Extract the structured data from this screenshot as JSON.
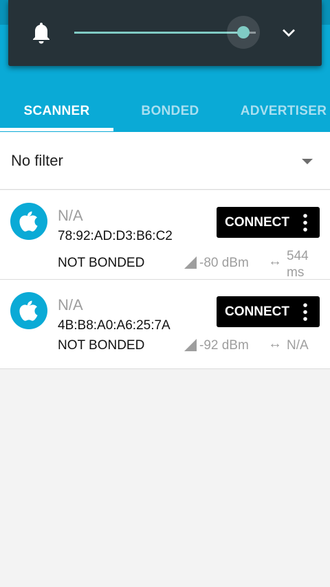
{
  "volume_panel": {
    "icon": "bell-icon",
    "level": 0.93,
    "accent_color": "#80cbc4",
    "expand_icon": "chevron-down-icon"
  },
  "tabs": [
    {
      "label": "SCANNER",
      "active": true
    },
    {
      "label": "BONDED",
      "active": false
    },
    {
      "label": "ADVERTISER",
      "active": false
    }
  ],
  "filter": {
    "selected": "No filter"
  },
  "devices": [
    {
      "icon": "apple-icon",
      "name": "N/A",
      "address": "78:92:AD:D3:B6:C2",
      "bond_state": "NOT BONDED",
      "connect_label": "CONNECT",
      "rssi": "-80 dBm",
      "interval_line1": "544",
      "interval_line2": "ms"
    },
    {
      "icon": "apple-icon",
      "name": "N/A",
      "address": "4B:B8:A0:A6:25:7A",
      "bond_state": "NOT BONDED",
      "connect_label": "CONNECT",
      "rssi": "-92 dBm",
      "interval_line1": "N/A",
      "interval_line2": ""
    }
  ],
  "colors": {
    "primary": "#0aaad6",
    "tab_inactive": "#a9dff0",
    "button": "#000000"
  }
}
